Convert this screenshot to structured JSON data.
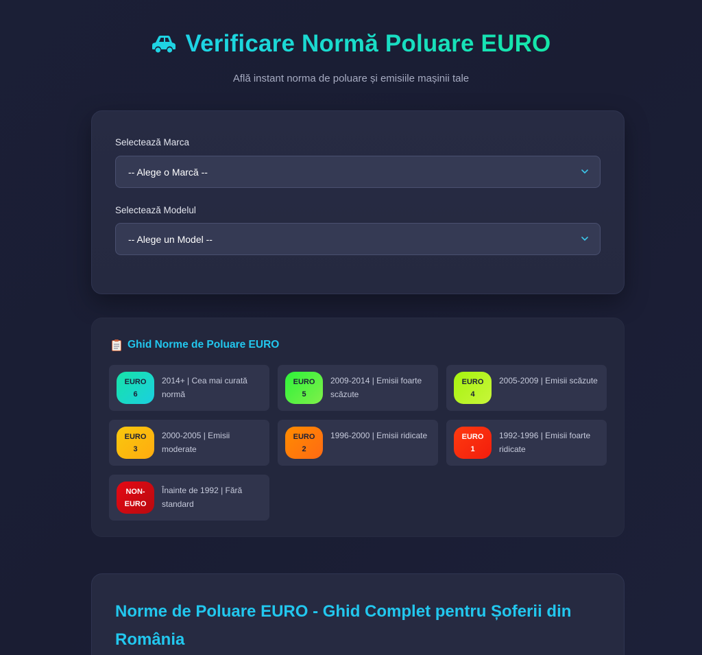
{
  "header": {
    "car_icon": "car-icon",
    "title": "Verificare Normă Poluare EURO",
    "subtitle": "Află instant norma de poluare și emisiile mașinii tale"
  },
  "selectors": {
    "brand_label": "Selectează Marca",
    "brand_value": "-- Alege o Marcă --",
    "model_label": "Selectează Modelul",
    "model_value": "-- Alege un Model --",
    "chevron_icon": "chevron-down-icon"
  },
  "guide": {
    "icon": "clipboard-icon",
    "title": "Ghid Norme de Poluare EURO",
    "norms": [
      {
        "line1": "EURO",
        "line2": "6",
        "desc": "2014+ | Cea mai curată normă",
        "colors": [
          "#17e3a8",
          "#1bcfe0"
        ]
      },
      {
        "line1": "EURO",
        "line2": "5",
        "desc": "2009-2014 | Emisii foarte scăzute",
        "colors": [
          "#2df23a",
          "#7ff04a"
        ]
      },
      {
        "line1": "EURO",
        "line2": "4",
        "desc": "2005-2009 | Emisii scăzute",
        "colors": [
          "#a6f40f",
          "#c8f53a"
        ]
      },
      {
        "line1": "EURO",
        "line2": "3",
        "desc": "2000-2005 | Emisii moderate",
        "colors": [
          "#f9c80e",
          "#ffab0f"
        ]
      },
      {
        "line1": "EURO",
        "line2": "2",
        "desc": "1996-2000 | Emisii ridicate",
        "colors": [
          "#ff8c00",
          "#ff6a13"
        ]
      },
      {
        "line1": "EURO",
        "line2": "1",
        "desc": "1992-1996 | Emisii foarte ridicate",
        "colors": [
          "#ff3b10",
          "#f21d0c"
        ]
      },
      {
        "line1": "NON-",
        "line2": "EURO",
        "desc": "Înainte de 1992 | Fără standard",
        "colors": [
          "#e50914",
          "#b80a0f"
        ]
      }
    ]
  },
  "info": {
    "title": "Norme de Poluare EURO - Ghid Complet pentru Șoferii din România"
  }
}
